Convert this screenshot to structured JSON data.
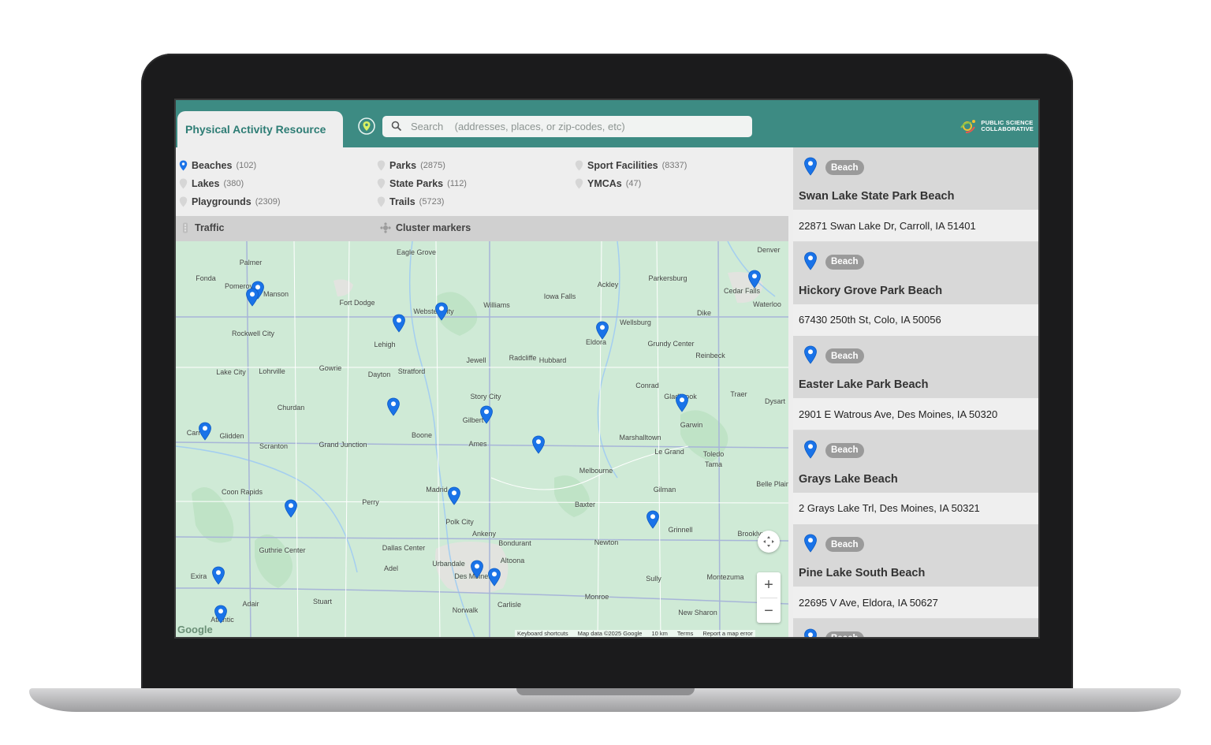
{
  "app": {
    "title": "Physical Activity Resource",
    "search_placeholder": "Search    (addresses, places, or zip-codes, etc)",
    "brand_line1": "PUBLIC SCIENCE",
    "brand_line2": "COLLABORATIVE"
  },
  "filters": {
    "col1": [
      {
        "name": "Beaches",
        "count": "(102)",
        "active": true
      },
      {
        "name": "Lakes",
        "count": "(380)",
        "active": false
      },
      {
        "name": "Playgrounds",
        "count": "(2309)",
        "active": false
      }
    ],
    "col2": [
      {
        "name": "Parks",
        "count": "(2875)",
        "active": false
      },
      {
        "name": "State Parks",
        "count": "(112)",
        "active": false
      },
      {
        "name": "Trails",
        "count": "(5723)",
        "active": false
      }
    ],
    "col3": [
      {
        "name": "Sport Facilities",
        "count": "(8337)",
        "active": false
      },
      {
        "name": "YMCAs",
        "count": "(47)",
        "active": false
      }
    ]
  },
  "toggles": {
    "traffic": "Traffic",
    "cluster": "Cluster markers"
  },
  "map": {
    "towns": [
      "Palmer",
      "Eagle Grove",
      "Denver",
      "Fonda",
      "Pomeroy",
      "Manson",
      "Fort Dodge",
      "Ackley",
      "Parkersburg",
      "Iowa Falls",
      "Cedar Falls",
      "Waterloo",
      "Webster City",
      "Williams",
      "Wellsburg",
      "Dike",
      "Rockwell City",
      "Lehigh",
      "Eldora",
      "Grundy Center",
      "Reinbeck",
      "Lake City",
      "Lohrville",
      "Gowrie",
      "Dayton",
      "Stratford",
      "Jewell",
      "Radcliffe",
      "Hubbard",
      "Conrad",
      "Gladbrook",
      "Traer",
      "Dysart",
      "Churdan",
      "Story City",
      "Gilbert",
      "Garwin",
      "Carroll",
      "Glidden",
      "Scranton",
      "Grand Junction",
      "Boone",
      "Ames",
      "Marshalltown",
      "Le Grand",
      "Toledo",
      "Tama",
      "Melbourne",
      "Belle Plaine",
      "Coon Rapids",
      "Perry",
      "Madrid",
      "Gilman",
      "Baxter",
      "Polk City",
      "Ankeny",
      "Grinnell",
      "Bondurant",
      "Newton",
      "Brooklyn",
      "Guthrie Center",
      "Dallas Center",
      "Adel",
      "Urbandale",
      "Altoona",
      "Des Moines",
      "Sully",
      "Montezuma",
      "Exira",
      "Adair",
      "Stuart",
      "Norwalk",
      "Carlisle",
      "Monroe",
      "New Sharon",
      "Atlantic"
    ],
    "attribution": [
      "Keyboard shortcuts",
      "Map data ©2025 Google",
      "10 km",
      "Terms",
      "Report a map error"
    ],
    "logo": "Google"
  },
  "results": [
    {
      "type": "Beach",
      "name": "Swan Lake State Park Beach",
      "address": "22871 Swan Lake Dr, Carroll, IA 51401"
    },
    {
      "type": "Beach",
      "name": "Hickory Grove Park Beach",
      "address": "67430 250th St, Colo, IA 50056"
    },
    {
      "type": "Beach",
      "name": "Easter Lake Park Beach",
      "address": "2901 E Watrous Ave, Des Moines, IA 50320"
    },
    {
      "type": "Beach",
      "name": "Grays Lake Beach",
      "address": "2 Grays Lake Trl, Des Moines, IA 50321"
    },
    {
      "type": "Beach",
      "name": "Pine Lake South Beach",
      "address": "22695 V Ave, Eldora, IA 50627"
    },
    {
      "type": "Beach",
      "name": "",
      "address": ""
    }
  ],
  "colors": {
    "header": "#3d8b83",
    "pin": "#1a73e8",
    "badge": "#9a9a9a"
  }
}
